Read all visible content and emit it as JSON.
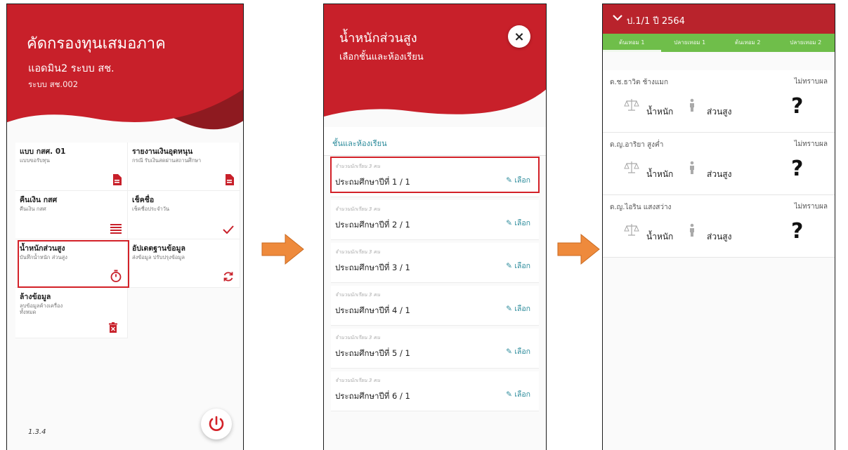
{
  "panel1": {
    "title": "คัดกรองทุนเสมอภาค",
    "user": "แอดมิน2 ระบบ สช.",
    "user_code": "ระบบ สช.002",
    "menu": [
      {
        "title": "แบบ กสศ. 01",
        "desc": "แบบขอรับทุน",
        "icon": "document-icon"
      },
      {
        "title": "รายงานเงินอุดหนุน",
        "desc": "กรณี รับเงินสดผ่านสถานศึกษา",
        "icon": "document-icon"
      },
      {
        "title": "คืนเงิน กสศ",
        "desc": "คืนเงิน กสศ",
        "icon": "list-icon"
      },
      {
        "title": "เช็คชื่อ",
        "desc": "เช็คชื่อประจำวัน",
        "icon": "check-icon"
      },
      {
        "title": "น้ำหนักส่วนสูง",
        "desc": "บันทึกน้ำหนัก ส่วนสูง",
        "icon": "stopwatch-icon"
      },
      {
        "title": "อัปเดตฐานข้อมูล",
        "desc": "ส่งข้อมูล ปรับปรุงข้อมูล",
        "icon": "sync-icon"
      },
      {
        "title": "ล้างข้อมูล",
        "desc": "ลบข้อมูลค้างเครื่อง ทั้งหมด",
        "icon": "trash-icon"
      }
    ],
    "version": "1.3.4",
    "accent": "#c8202a"
  },
  "panel2": {
    "title": "น้ำหนักส่วนสูง",
    "subtitle": "เลือกชั้นและห้องเรียน",
    "close_symbol": "×",
    "section_label": "ชั้นและห้องเรียน",
    "classes": [
      {
        "count": "จำนวนนักเรียน 3 คน",
        "name": "ประถมศึกษาปีที่ 1 / 1",
        "action": "เลือก"
      },
      {
        "count": "จำนวนนักเรียน 3 คน",
        "name": "ประถมศึกษาปีที่ 2 / 1",
        "action": "เลือก"
      },
      {
        "count": "จำนวนนักเรียน 3 คน",
        "name": "ประถมศึกษาปีที่ 3 / 1",
        "action": "เลือก"
      },
      {
        "count": "จำนวนนักเรียน 3 คน",
        "name": "ประถมศึกษาปีที่ 4 / 1",
        "action": "เลือก"
      },
      {
        "count": "จำนวนนักเรียน 3 คน",
        "name": "ประถมศึกษาปีที่ 5 / 1",
        "action": "เลือก"
      },
      {
        "count": "จำนวนนักเรียน 3 คน",
        "name": "ประถมศึกษาปีที่ 6 / 1",
        "action": "เลือก"
      }
    ]
  },
  "panel3": {
    "header": "ป.1/1 ปี 2564",
    "tabs": [
      "ต้นเทอม 1",
      "ปลายเทอม 1",
      "ต้นเทอม 2",
      "ปลายเทอม 2"
    ],
    "students": [
      {
        "name": "ด.ช.ธาวิต ช้างแมก",
        "result": "ไม่ทราบผล",
        "weight_label": "น้ำหนัก",
        "height_label": "ส่วนสูง",
        "status": "?"
      },
      {
        "name": "ด.ญ.อาริยา สูงค่ำ",
        "result": "ไม่ทราบผล",
        "weight_label": "น้ำหนัก",
        "height_label": "ส่วนสูง",
        "status": "?"
      },
      {
        "name": "ด.ญ.ไอริน แสงสว่าง",
        "result": "ไม่ทราบผล",
        "weight_label": "น้ำหนัก",
        "height_label": "ส่วนสูง",
        "status": "?"
      }
    ],
    "accent": "#b9232c",
    "tab_color": "#6fbe4a"
  },
  "arrow_color": "#ee8a3c"
}
